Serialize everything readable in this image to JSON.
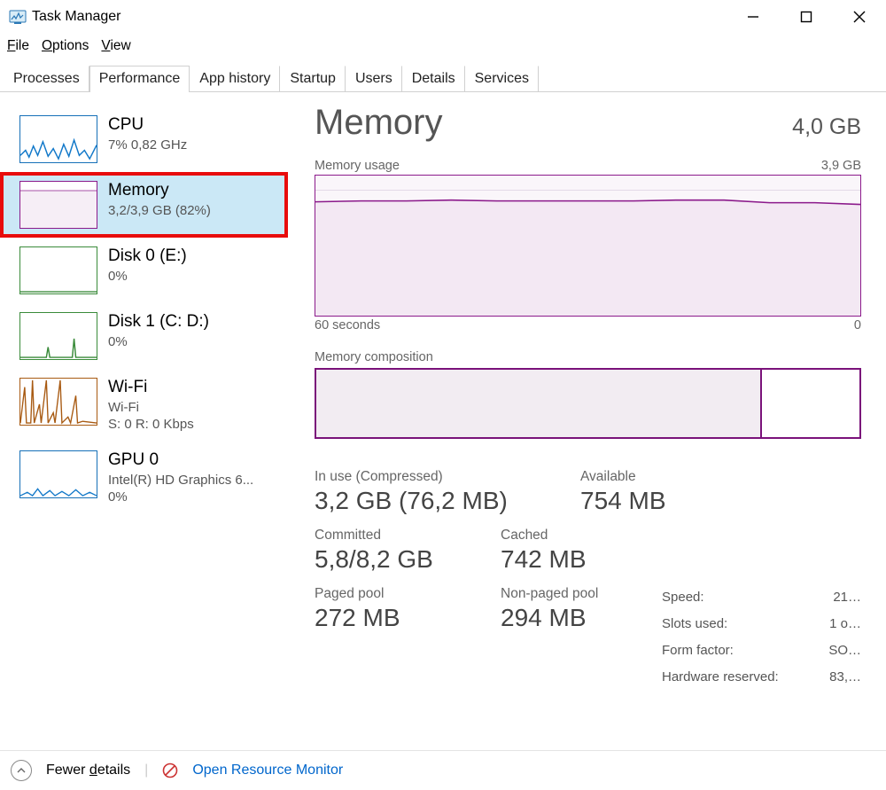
{
  "window": {
    "title": "Task Manager"
  },
  "menu": {
    "file": "File",
    "options": "Options",
    "view": "View"
  },
  "tabs": {
    "processes": "Processes",
    "performance": "Performance",
    "apphistory": "App history",
    "startup": "Startup",
    "users": "Users",
    "details": "Details",
    "services": "Services",
    "active": "performance"
  },
  "sidebar": {
    "items": [
      {
        "title": "CPU",
        "sub": "7%  0,82 GHz",
        "sub2": ""
      },
      {
        "title": "Memory",
        "sub": "3,2/3,9 GB (82%)",
        "sub2": ""
      },
      {
        "title": "Disk 0 (E:)",
        "sub": "0%",
        "sub2": ""
      },
      {
        "title": "Disk 1 (C: D:)",
        "sub": "0%",
        "sub2": ""
      },
      {
        "title": "Wi-Fi",
        "sub": "Wi-Fi",
        "sub2": "S: 0  R: 0 Kbps"
      },
      {
        "title": "GPU 0",
        "sub": "Intel(R) HD Graphics 6...",
        "sub2": "0%"
      }
    ],
    "selected": 1
  },
  "detail": {
    "heading": "Memory",
    "total": "4,0 GB",
    "usage_label": "Memory usage",
    "usage_max": "3,9 GB",
    "axis_left": "60 seconds",
    "axis_right": "0",
    "comp_label": "Memory composition",
    "stats": {
      "inuse_label": "In use (Compressed)",
      "inuse_value": "3,2 GB (76,2 MB)",
      "avail_label": "Available",
      "avail_value": "754 MB",
      "committed_label": "Committed",
      "committed_value": "5,8/8,2 GB",
      "cached_label": "Cached",
      "cached_value": "742 MB",
      "paged_label": "Paged pool",
      "paged_value": "272 MB",
      "nonpaged_label": "Non-paged pool",
      "nonpaged_value": "294 MB"
    },
    "props": {
      "speed_label": "Speed:",
      "speed_value": "21…",
      "slots_label": "Slots used:",
      "slots_value": "1 o…",
      "form_label": "Form factor:",
      "form_value": "SO…",
      "hw_label": "Hardware reserved:",
      "hw_value": "83,…"
    }
  },
  "footer": {
    "fewer": "Fewer details",
    "open_rm": "Open Resource Monitor"
  },
  "chart_data": {
    "type": "line",
    "title": "Memory usage",
    "xlabel": "seconds",
    "ylabel": "GB",
    "xlim": [
      60,
      0
    ],
    "ylim": [
      0,
      3.9
    ],
    "x": [
      60,
      55,
      50,
      45,
      40,
      35,
      30,
      25,
      20,
      15,
      10,
      5,
      0
    ],
    "values": [
      3.18,
      3.19,
      3.19,
      3.2,
      3.19,
      3.19,
      3.19,
      3.19,
      3.2,
      3.2,
      3.17,
      3.17,
      3.15
    ],
    "memory_composition": {
      "in_use_pct": 82,
      "free_pct": 18
    }
  }
}
